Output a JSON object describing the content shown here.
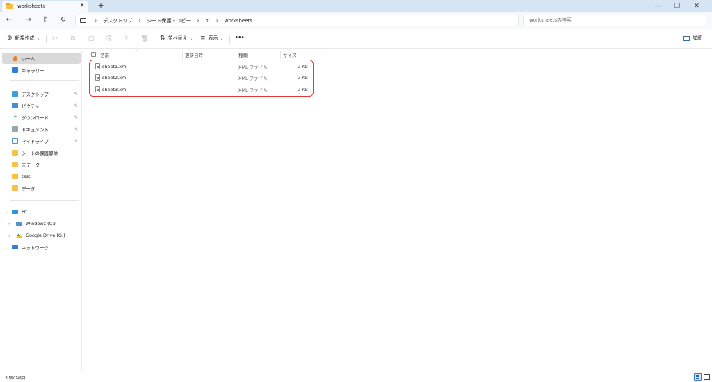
{
  "window": {
    "tab_title": "worksheets",
    "tab_close": "✕",
    "new_tab": "+",
    "minimize": "—",
    "restore": "❐",
    "close": "✕"
  },
  "navigation": {
    "back": "←",
    "forward": "→",
    "up": "↑",
    "refresh": "↻",
    "breadcrumbs": [
      "デスクトップ",
      "シート保護 - コピー",
      "xl",
      "worksheets"
    ],
    "separator": "›",
    "search_placeholder": "worksheetsの検索"
  },
  "commandbar": {
    "new_label": "新規作成",
    "sort_label": "並べ替え",
    "view_label": "表示",
    "more": "•••",
    "details_label": "詳細"
  },
  "sidebar": {
    "quick": [
      {
        "label": "ホーム",
        "icon": "home-icon",
        "active": true
      },
      {
        "label": "ギャラリー",
        "icon": "gallery-icon"
      }
    ],
    "pinned": [
      {
        "label": "デスクトップ",
        "icon": "desktop-icon",
        "pinned": true
      },
      {
        "label": "ピクチャ",
        "icon": "pictures-icon",
        "pinned": true
      },
      {
        "label": "ダウンロード",
        "icon": "download-icon",
        "pinned": true
      },
      {
        "label": "ドキュメント",
        "icon": "documents-icon",
        "pinned": true
      },
      {
        "label": "マイドライブ",
        "icon": "mydrive-icon",
        "pinned": true
      },
      {
        "label": "シートの保護解除",
        "icon": "folder-icon"
      },
      {
        "label": "元データ",
        "icon": "folder-icon"
      },
      {
        "label": "test",
        "icon": "folder-icon"
      },
      {
        "label": "データ",
        "icon": "folder-icon"
      }
    ],
    "devices": [
      {
        "label": "PC",
        "icon": "pc-icon",
        "expander": "⌄"
      },
      {
        "label": "Windows (C:)",
        "icon": "windows-drive-icon",
        "expander": "›"
      },
      {
        "label": "Google Drive (G:)",
        "icon": "google-drive-icon",
        "expander": "›"
      },
      {
        "label": "ネットワーク",
        "icon": "network-icon",
        "expander": "›"
      }
    ],
    "pin_glyph": "📌"
  },
  "columns": {
    "name": "名前",
    "modified": "更新日時",
    "type": "種類",
    "size": "サイズ"
  },
  "files": [
    {
      "name": "sheet1.xml",
      "type": "XML ファイル",
      "size": "2 KB"
    },
    {
      "name": "sheet2.xml",
      "type": "XML ファイル",
      "size": "2 KB"
    },
    {
      "name": "sheet3.xml",
      "type": "XML ファイル",
      "size": "2 KB"
    }
  ],
  "status": {
    "item_count": "3 個の項目"
  },
  "colors": {
    "titlebar": "#d6e5f4",
    "highlight_border": "#e53935",
    "accent": "#3a7bd5"
  }
}
